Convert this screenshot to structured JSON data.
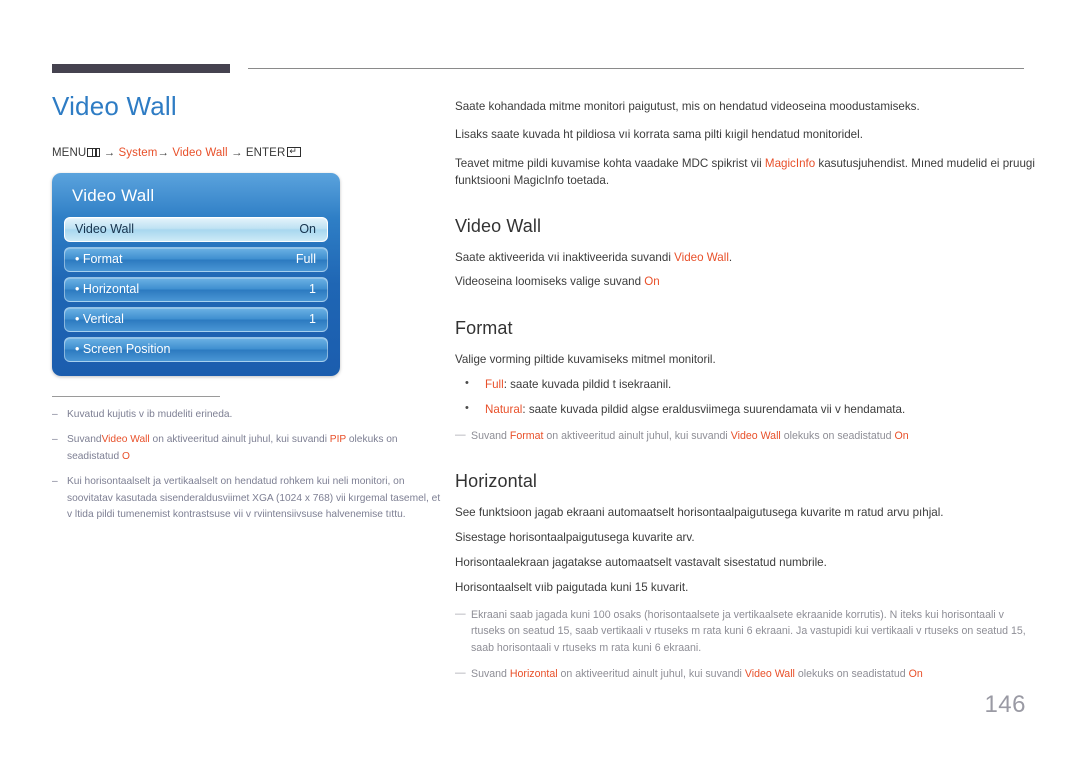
{
  "page": {
    "number": "146",
    "title": "Video Wall"
  },
  "menu_path": {
    "prefix": "MENU",
    "menu_icon": "menu-grid-icon",
    "arrow": "→",
    "item1": "System",
    "item2": "Video Wall",
    "suffix": "ENTER",
    "enter_icon": "enter-key-icon"
  },
  "osd": {
    "title": "Video Wall",
    "rows": [
      {
        "label": "Video Wall",
        "value": "On",
        "selected": true
      },
      {
        "label": "• Format",
        "value": "Full",
        "selected": false
      },
      {
        "label": "• Horizontal",
        "value": "1",
        "selected": false
      },
      {
        "label": "• Vertical",
        "value": "1",
        "selected": false
      },
      {
        "label": "• Screen Position",
        "value": "",
        "selected": false
      }
    ]
  },
  "left_notes": [
    {
      "dash": "–",
      "segments": [
        {
          "text": "Kuvatud kujutis v ib mudeliti erineda.",
          "hl": false
        }
      ]
    },
    {
      "dash": "–",
      "segments": [
        {
          "text": "Suvand",
          "hl": false
        },
        {
          "text": "Video Wall",
          "hl": true
        },
        {
          "text": " on aktiveeritud ainult juhul, kui suvandi ",
          "hl": false
        },
        {
          "text": "PIP",
          "hl": true
        },
        {
          "text": " olekuks on seadistatud ",
          "hl": false
        },
        {
          "text": "O",
          "hl": true
        }
      ]
    },
    {
      "dash": "–",
      "segments": [
        {
          "text": "Kui horisontaalselt ja vertikaalselt on  hendatud rohkem kui neli monitori, on soovitatav kasutada sisenderaldusviimet XGA (1024 x 768) vii kırgemal tasemel, et v ltida pildi tumenemist kontrastsuse vii v rviintensiivsuse halvenemise tıttu.",
          "hl": false
        }
      ]
    }
  ],
  "intro": [
    {
      "segments": [
        {
          "text": "Saate kohandada mitme monitori paigutust, mis on  hendatud videoseina moodustamiseks.",
          "hl": false
        }
      ]
    },
    {
      "segments": [
        {
          "text": "Lisaks saate kuvada  ht pildiosa vıi korrata sama pilti kıigil  hendatud monitoridel.",
          "hl": false
        }
      ]
    },
    {
      "segments": [
        {
          "text": "Teavet mitme pildi kuvamise kohta vaadake MDC spikrist vii ",
          "hl": false
        },
        {
          "text": "MagicInfo",
          "hl": true
        },
        {
          "text": " kasutusjuhendist. Mıned mudelid ei pruugi funktsiooni MagicInfo toetada.",
          "hl": false
        }
      ]
    }
  ],
  "sections": [
    {
      "heading": "Video Wall",
      "blocks": [
        {
          "kind": "line",
          "segments": [
            {
              "text": "Saate aktiveerida vıi inaktiveerida suvandi ",
              "hl": false
            },
            {
              "text": "Video Wall",
              "hl": true
            },
            {
              "text": ".",
              "hl": false
            }
          ]
        },
        {
          "kind": "line",
          "segments": [
            {
              "text": "Videoseina loomiseks valige suvand ",
              "hl": false
            },
            {
              "text": "On",
              "hl": true
            }
          ]
        }
      ]
    },
    {
      "heading": "Format",
      "blocks": [
        {
          "kind": "line",
          "segments": [
            {
              "text": "Valige vorming piltide kuvamiseks mitmel monitoril.",
              "hl": false
            }
          ]
        },
        {
          "kind": "bullet",
          "segments": [
            {
              "text": "Full",
              "hl": true
            },
            {
              "text": ": saate kuvada pildid t isekraanil.",
              "hl": false
            }
          ]
        },
        {
          "kind": "bullet",
          "segments": [
            {
              "text": "Natural",
              "hl": true
            },
            {
              "text": ": saate kuvada pildid algse eraldusviimega suurendamata vii v hendamata.",
              "hl": false
            }
          ]
        },
        {
          "kind": "note",
          "dash": "—",
          "segments": [
            {
              "text": "Suvand ",
              "hl": false
            },
            {
              "text": "Format",
              "hl": true
            },
            {
              "text": " on aktiveeritud ainult juhul, kui suvandi ",
              "hl": false
            },
            {
              "text": "Video Wall",
              "hl": true
            },
            {
              "text": " olekuks on seadistatud ",
              "hl": false
            },
            {
              "text": "On",
              "hl": true
            }
          ]
        }
      ]
    },
    {
      "heading": "Horizontal",
      "blocks": [
        {
          "kind": "line",
          "segments": [
            {
              "text": "See funktsioon jagab ekraani automaatselt horisontaalpaigutusega kuvarite m  ratud arvu pıhjal.",
              "hl": false
            }
          ]
        },
        {
          "kind": "line",
          "segments": [
            {
              "text": "Sisestage horisontaalpaigutusega kuvarite arv.",
              "hl": false
            }
          ]
        },
        {
          "kind": "line",
          "segments": [
            {
              "text": "Horisontaalekraan jagatakse automaatselt vastavalt sisestatud numbrile.",
              "hl": false
            }
          ]
        },
        {
          "kind": "line",
          "segments": [
            {
              "text": "Horisontaalselt vıib paigutada kuni 15 kuvarit.",
              "hl": false
            }
          ]
        },
        {
          "kind": "note",
          "dash": "—",
          "segments": [
            {
              "text": "Ekraani saab jagada kuni 100 osaks (horisontaalsete ja vertikaalsete ekraanide korrutis). N iteks kui horisontaali v  rtuseks on seatud 15, saab vertikaali v  rtuseks m  rata kuni 6 ekraani. Ja vastupidi  kui vertikaali v  rtuseks on seatud 15, saab horisontaali v  rtuseks m  rata kuni 6 ekraani.",
              "hl": false
            }
          ]
        },
        {
          "kind": "note",
          "dash": "—",
          "segments": [
            {
              "text": "Suvand ",
              "hl": false
            },
            {
              "text": "Horizontal",
              "hl": true
            },
            {
              "text": " on aktiveeritud ainult juhul, kui suvandi ",
              "hl": false
            },
            {
              "text": "Video Wall",
              "hl": true
            },
            {
              "text": " olekuks on seadistatud ",
              "hl": false
            },
            {
              "text": "On",
              "hl": true
            }
          ]
        }
      ]
    }
  ],
  "colors": {
    "title_blue": "#2e7cc4",
    "highlight_orange": "#e8502a",
    "osd_blue": "#2f7fc6",
    "rule_dark": "#45424f",
    "page_number_gray": "#9a9aa4"
  }
}
